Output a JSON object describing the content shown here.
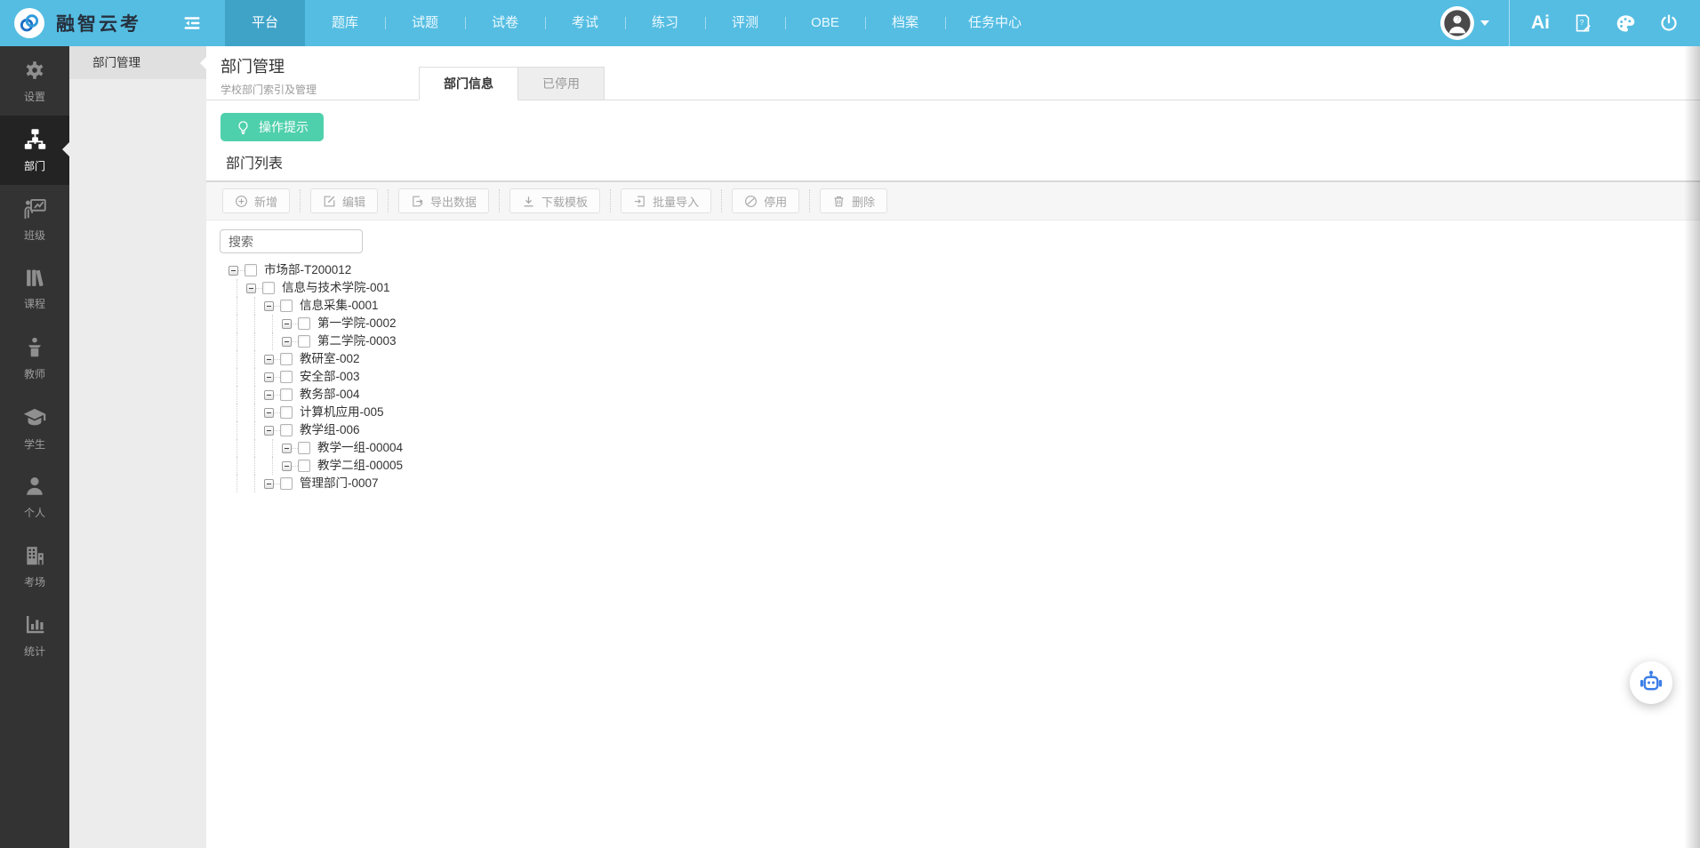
{
  "colors": {
    "navbar_bg": "#55bde2",
    "navbar_active_bg": "#3fa3c8",
    "sidebar_bg": "#333333",
    "accent_green": "#4fd0ac",
    "robot_blue": "#3e7fe8"
  },
  "navbar": {
    "brand": "融智云考",
    "items": [
      {
        "label": "平台",
        "active": true
      },
      {
        "label": "题库"
      },
      {
        "label": "试题"
      },
      {
        "label": "试卷"
      },
      {
        "label": "考试"
      },
      {
        "label": "练习"
      },
      {
        "label": "评测"
      },
      {
        "label": "OBE"
      },
      {
        "label": "档案"
      },
      {
        "label": "任务中心"
      }
    ],
    "right": {
      "ai_label": "Ai"
    }
  },
  "sidebar": {
    "items": [
      {
        "label": "设置",
        "icon": "gear"
      },
      {
        "label": "部门",
        "icon": "org",
        "active": true
      },
      {
        "label": "班级",
        "icon": "class-board"
      },
      {
        "label": "课程",
        "icon": "books"
      },
      {
        "label": "教师",
        "icon": "teacher"
      },
      {
        "label": "学生",
        "icon": "grad-cap"
      },
      {
        "label": "个人",
        "icon": "person"
      },
      {
        "label": "考场",
        "icon": "building"
      },
      {
        "label": "统计",
        "icon": "bar-chart"
      }
    ]
  },
  "submenu": {
    "items": [
      {
        "label": "部门管理",
        "active": true
      }
    ]
  },
  "page": {
    "title": "部门管理",
    "subtitle": "学校部门索引及管理",
    "tabs": [
      {
        "label": "部门信息",
        "active": true
      },
      {
        "label": "已停用"
      }
    ],
    "hint_button": "操作提示",
    "section_title": "部门列表",
    "toolbar": [
      {
        "label": "新增",
        "icon": "plus-circle"
      },
      {
        "label": "编辑",
        "icon": "edit"
      },
      {
        "label": "导出数据",
        "icon": "export"
      },
      {
        "label": "下载模板",
        "icon": "download"
      },
      {
        "label": "批量导入",
        "icon": "import"
      },
      {
        "label": "停用",
        "icon": "ban"
      },
      {
        "label": "删除",
        "icon": "trash"
      }
    ],
    "search_placeholder": "搜索",
    "tree": [
      {
        "label": "市场部-T200012",
        "level": 0
      },
      {
        "label": "信息与技术学院-001",
        "level": 1
      },
      {
        "label": "信息采集-0001",
        "level": 2
      },
      {
        "label": "第一学院-0002",
        "level": 3
      },
      {
        "label": "第二学院-0003",
        "level": 3
      },
      {
        "label": "教研室-002",
        "level": 2
      },
      {
        "label": "安全部-003",
        "level": 2
      },
      {
        "label": "教务部-004",
        "level": 2
      },
      {
        "label": "计算机应用-005",
        "level": 2
      },
      {
        "label": "教学组-006",
        "level": 2
      },
      {
        "label": "教学一组-00004",
        "level": 3
      },
      {
        "label": "教学二组-00005",
        "level": 3
      },
      {
        "label": "管理部门-0007",
        "level": 2
      }
    ]
  }
}
